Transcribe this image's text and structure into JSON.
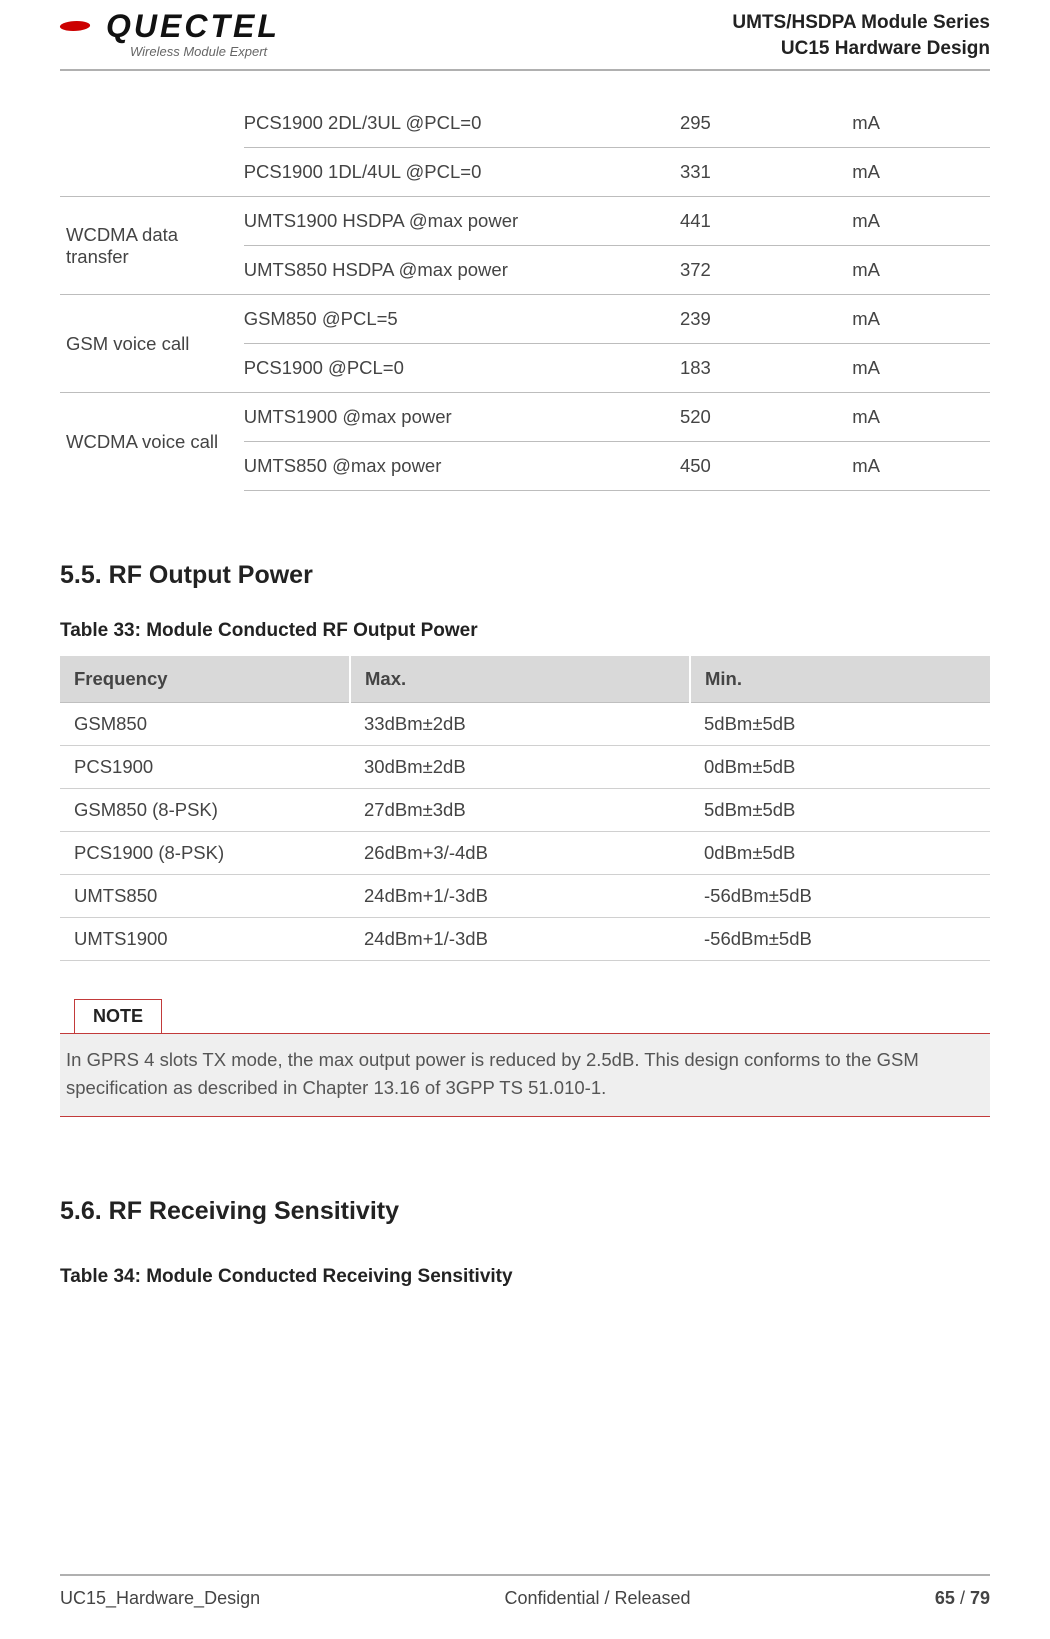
{
  "header": {
    "logo_text": "QUECTEL",
    "logo_sub": "Wireless Module Expert",
    "line1": "UMTS/HSDPA  Module  Series",
    "line2": "UC15  Hardware  Design"
  },
  "table1": {
    "groups": [
      {
        "label": "",
        "rows": [
          {
            "cond": "PCS1900 2DL/3UL @PCL=0",
            "val": "295",
            "unit": "mA"
          },
          {
            "cond": "PCS1900 1DL/4UL @PCL=0",
            "val": "331",
            "unit": "mA"
          }
        ]
      },
      {
        "label": "WCDMA data transfer",
        "rows": [
          {
            "cond": "UMTS1900 HSDPA @max power",
            "val": "441",
            "unit": "mA"
          },
          {
            "cond": "UMTS850 HSDPA @max power",
            "val": "372",
            "unit": "mA"
          }
        ]
      },
      {
        "label": "GSM voice call",
        "rows": [
          {
            "cond": "GSM850 @PCL=5",
            "val": "239",
            "unit": "mA"
          },
          {
            "cond": "PCS1900 @PCL=0",
            "val": "183",
            "unit": "mA"
          }
        ]
      },
      {
        "label": "WCDMA  voice call",
        "rows": [
          {
            "cond": "UMTS1900 @max power",
            "val": "520",
            "unit": "mA"
          },
          {
            "cond": "UMTS850 @max power",
            "val": "450",
            "unit": "mA"
          }
        ]
      }
    ]
  },
  "section55": {
    "heading": "5.5. RF Output Power",
    "table_title": "Table 33: Module Conducted RF Output Power",
    "headers": {
      "h1": "Frequency",
      "h2": "Max.",
      "h3": "Min."
    },
    "rows": [
      {
        "freq": "GSM850",
        "max": "33dBm±2dB",
        "min": "5dBm±5dB"
      },
      {
        "freq": "PCS1900",
        "max": "30dBm±2dB",
        "min": "0dBm±5dB"
      },
      {
        "freq": "GSM850 (8-PSK)",
        "max": "27dBm±3dB",
        "min": "5dBm±5dB"
      },
      {
        "freq": "PCS1900 (8-PSK)",
        "max": "26dBm+3/-4dB",
        "min": "0dBm±5dB"
      },
      {
        "freq": "UMTS850",
        "max": "24dBm+1/-3dB",
        "min": "-56dBm±5dB"
      },
      {
        "freq": "UMTS1900",
        "max": "24dBm+1/-3dB",
        "min": "-56dBm±5dB"
      }
    ]
  },
  "note": {
    "label": "NOTE",
    "text": "In GPRS 4 slots TX mode, the max output power is reduced by 2.5dB. This design conforms to the GSM specification as described in Chapter 13.16 of 3GPP TS 51.010-1."
  },
  "section56": {
    "heading": "5.6. RF Receiving Sensitivity",
    "table_title": "Table 34: Module Conducted Receiving Sensitivity"
  },
  "footer": {
    "left": "UC15_Hardware_Design",
    "mid": "Confidential / Released",
    "page_current": "65",
    "page_sep": " / ",
    "page_total": "79"
  }
}
